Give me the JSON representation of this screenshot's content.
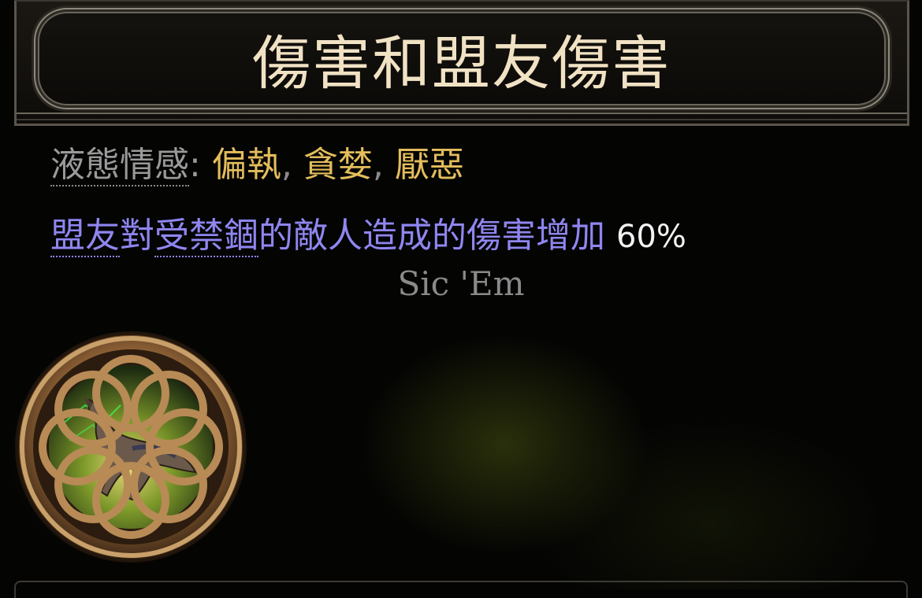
{
  "tooltip": {
    "title": "傷害和盟友傷害",
    "requirement": {
      "label": "液態情感",
      "colon": ":",
      "emotions": [
        "偏執",
        "貪婪",
        "厭惡"
      ],
      "separator": ","
    },
    "modifier": {
      "keyword_1": "盟友",
      "text_1": "對",
      "keyword_2": "受禁錮",
      "text_2": "的敵人造成的傷害增加",
      "value": "60%"
    },
    "flavor": "Sic 'Em",
    "icon": "notable-passive-drake-icon",
    "colors": {
      "title": "#f1e2c4",
      "emotion": "#e3bd5c",
      "modifier": "#8f86f0",
      "value": "#f2f2f2",
      "flavor": "#8a8a8a"
    }
  }
}
